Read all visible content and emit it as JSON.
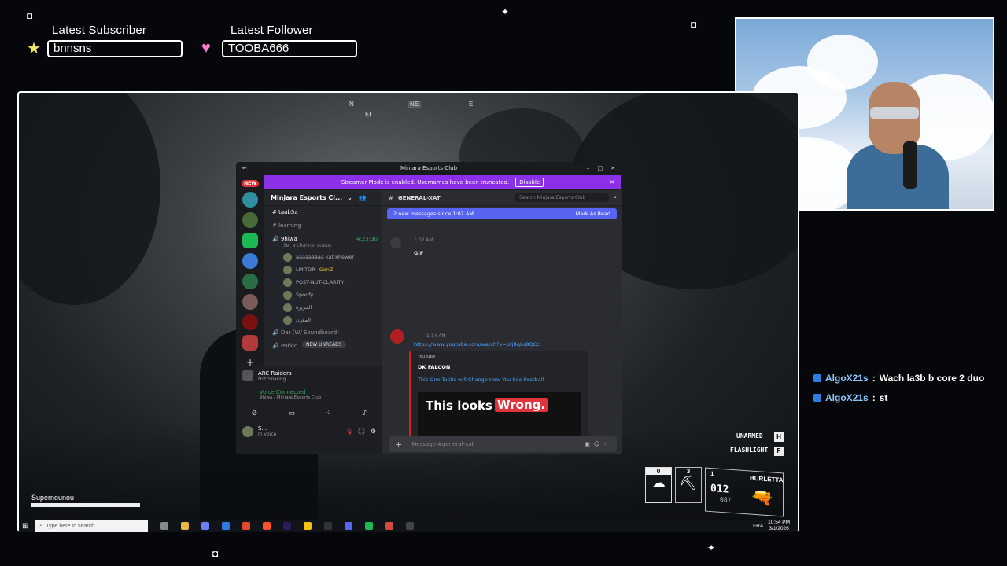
{
  "overlay": {
    "latest_subscriber_label": "Latest Subscriber",
    "latest_subscriber_value": "bnnsns",
    "latest_follower_label": "Latest Follower",
    "latest_follower_value": "TOOBA666",
    "colors": {
      "accent_star": "#f4e36a",
      "accent_heart": "#ff7ac8"
    }
  },
  "game": {
    "compass": [
      "N",
      "NE",
      "E"
    ],
    "hud": {
      "unarmed_label": "UNARMED",
      "unarmed_key": "H",
      "flashlight_label": "FLASHLIGHT",
      "flashlight_key": "F",
      "slot0_count": "0",
      "slot3_count": "3",
      "slot1_count": "1",
      "weapon_name": "BURLETTA",
      "ammo_current": "012",
      "ammo_reserve": "087"
    },
    "player_name": "Supernounou"
  },
  "discord": {
    "window_title": "Minjara Esports Club",
    "streamer_banner": "Streamer Mode is enabled. Usernames have been truncated.",
    "disable_label": "Disable",
    "new_badge": "NEW",
    "server_name": "Minjara Esports Cl...",
    "channels": {
      "text1": "taab3a",
      "text2": "learning",
      "voice_name": "9hiwa",
      "voice_time": "4:23:30",
      "voice_status": "Set a channel status",
      "voice_users": [
        "aaaaaaaaa kat khewer",
        "LMITOR",
        "POST-NUT-CLARITY",
        "Spoofy",
        "الجزيرة",
        "المغزن"
      ],
      "genz_tag": "GenZ",
      "voice2": "Dar (W/ Soundboard)",
      "voice3": "Public",
      "new_unreads": "NEW UNREADS"
    },
    "activity": {
      "game": "ARC Raiders",
      "status": "Not Sharing"
    },
    "voice_connected": {
      "title": "Voice Connected",
      "subtitle": "9hiwa / Minjara Esports Club"
    },
    "user": {
      "name": "S...",
      "status": "In voice"
    },
    "chat": {
      "channel": "general-xat",
      "search_placeholder": "Search Minjara Esports Club",
      "new_messages": "2 new messages since 1:02 AM",
      "mark_as_read": "Mark As Read",
      "msg1_time": "1:02 AM",
      "msg1_text": "GIF",
      "msg2_time": "1:14 AM",
      "msg2_link": "https://www.youtube.com/watch?v=ptjRqLo8QCc",
      "embed_provider": "YouTube",
      "embed_author": "DK FALCON",
      "embed_title": "This One Tactic will Change How You See Football",
      "thumb_text_1": "This looks",
      "thumb_text_2": "Wrong.",
      "input_placeholder": "Message #general-xat"
    }
  },
  "taskbar": {
    "search_placeholder": "Type here to search",
    "lang": "FRA",
    "time": "10:54 PM",
    "date": "3/1/2026"
  },
  "stream_chat": [
    {
      "user": "AlgoX21s",
      "message": "Wach la3b b core 2 duo"
    },
    {
      "user": "AlgoX21s",
      "message": "st"
    }
  ]
}
